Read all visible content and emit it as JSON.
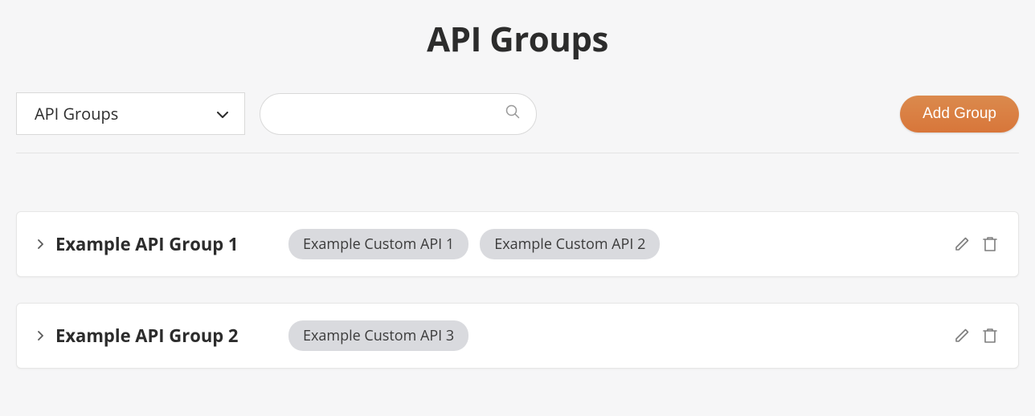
{
  "title": "API Groups",
  "filter": {
    "selected_label": "API Groups"
  },
  "search": {
    "value": "",
    "placeholder": ""
  },
  "add_button_label": "Add Group",
  "groups": [
    {
      "name": "Example API Group 1",
      "tags": [
        "Example Custom API 1",
        "Example Custom API 2"
      ]
    },
    {
      "name": "Example API Group 2",
      "tags": [
        "Example Custom API 3"
      ]
    }
  ]
}
